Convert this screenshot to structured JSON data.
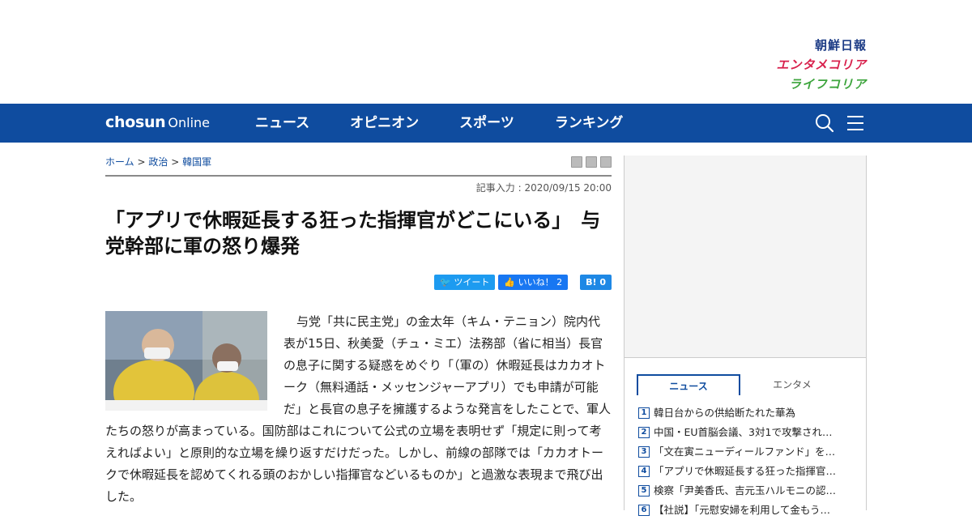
{
  "brands": [
    "朝鮮日報",
    "エンタメコリア",
    "ライフコリア"
  ],
  "logo": {
    "bold": "chosun",
    "light": "Online"
  },
  "menu": [
    "ニュース",
    "オピニオン",
    "スポーツ",
    "ランキング"
  ],
  "icons": {
    "search": "search-icon",
    "menu": "hamburger-menu-icon"
  },
  "breadcrumb": {
    "home": "ホーム",
    "sep": ">",
    "politics": "政治",
    "military": "韓国軍"
  },
  "dateline": "記事入力 : 2020/09/15 20:00",
  "headline": "「アプリで休暇延長する狂った指揮官がどこにいる」　与党幹部に軍の怒り爆発",
  "share": {
    "tweet": "ツイート",
    "like": "いいね！ 2",
    "hatena": "B! 0"
  },
  "body": "与党「共に民主党」の金太年（キム・テニョン）院内代表が15日、秋美愛（チュ・ミエ）法務部（省に相当）長官の息子に関する疑惑をめぐり「（軍の）休暇延長はカカオトーク（無料通話・メッセンジャーアプリ）でも申請が可能だ」と長官の息子を擁護するような発言をしたことで、軍人たちの怒りが高まっている。国防部はこれについて公式の立場を表明せず「規定に則って考えればよい」と原則的な立場を繰り返すだけだった。しかし、前線の部隊では「カカオトークで休暇延長を認めてくれる頭のおかしい指揮官などいるものか」と過激な表現まで飛び出した。",
  "sidebar": {
    "tabs": [
      "ニュース",
      "エンタメ"
    ],
    "ranking": [
      "韓日台からの供給断たれた華為",
      "中国・EU首脳会議、3対1で攻撃され…",
      "「文在寅ニューディールファンド」を…",
      "「アプリで休暇延長する狂った指揮官…",
      "検察「尹美香氏、吉元玉ハルモニの認…",
      "【社説】「元慰安婦を利用して金もう…"
    ]
  },
  "colors": {
    "nav": "#0f4c9f",
    "accent": "#d8204c",
    "green": "#3ca43c"
  }
}
